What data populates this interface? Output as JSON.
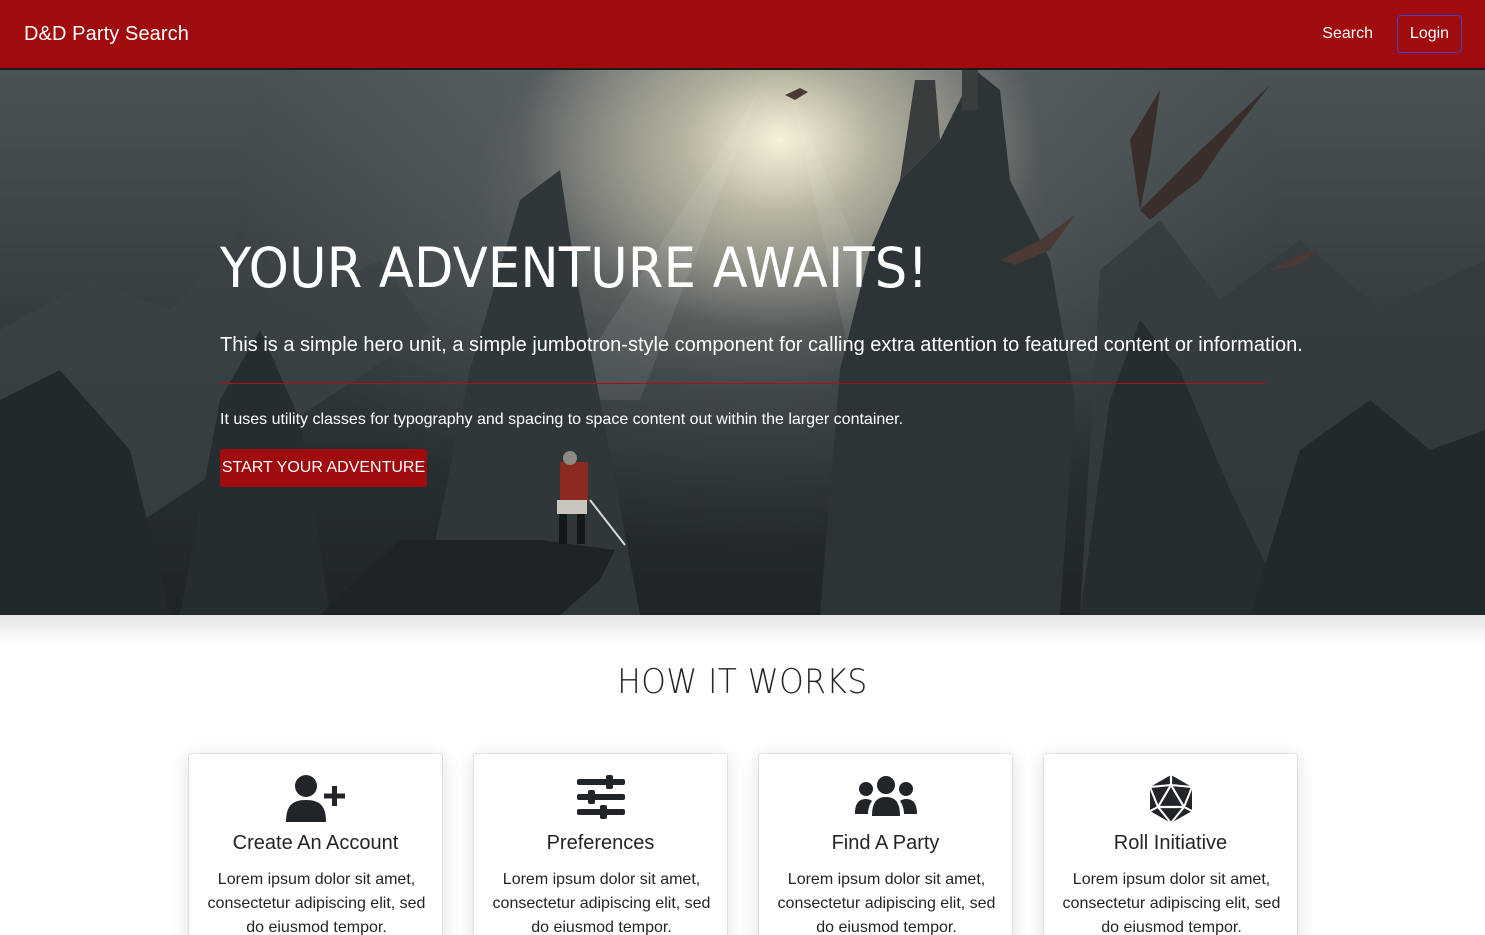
{
  "navbar": {
    "brand": "D&D Party Search",
    "search_link": "Search",
    "login_button": "Login"
  },
  "hero": {
    "title": "YOUR ADVENTURE AWAITS!",
    "lead": "This is a simple hero unit, a simple jumbotron-style component for calling extra attention to featured content or information.",
    "text": "It uses utility classes for typography and spacing to space content out within the larger container.",
    "button": "START YOUR ADVENTURE"
  },
  "how_it_works": {
    "title": "HOW IT WORKS",
    "cards": [
      {
        "icon": "user-plus-icon",
        "title": "Create An Account",
        "text": "Lorem ipsum dolor sit amet, consectetur adipiscing elit, sed do eiusmod tempor."
      },
      {
        "icon": "sliders-icon",
        "title": "Preferences",
        "text": "Lorem ipsum dolor sit amet, consectetur adipiscing elit, sed do eiusmod tempor."
      },
      {
        "icon": "users-icon",
        "title": "Find A Party",
        "text": "Lorem ipsum dolor sit amet, consectetur adipiscing elit, sed do eiusmod tempor."
      },
      {
        "icon": "d20-dice-icon",
        "title": "Roll Initiative",
        "text": "Lorem ipsum dolor sit amet, consectetur adipiscing elit, sed do eiusmod tempor."
      }
    ]
  },
  "colors": {
    "brand_red": "#a00b0e",
    "login_border": "#3d46c9",
    "text_dark": "#212529"
  }
}
